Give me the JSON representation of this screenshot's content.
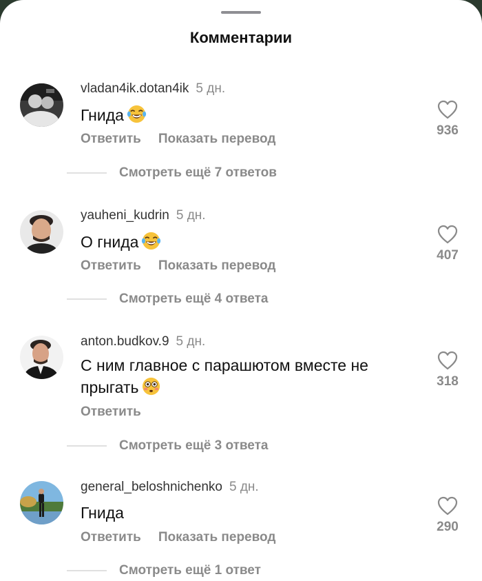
{
  "header": {
    "title": "Комментарии"
  },
  "comments": [
    {
      "username": "vladan4ik.dotan4ik",
      "time": "5 дн.",
      "text": "Гнида",
      "emoji": "laughing-emoji",
      "reply_label": "Ответить",
      "translate_label": "Показать перевод",
      "likes": "936",
      "more_replies": "Смотреть ещё 7 ответов"
    },
    {
      "username": "yauheni_kudrin",
      "time": "5 дн.",
      "text": "О гнида",
      "emoji": "laughing-emoji",
      "reply_label": "Ответить",
      "translate_label": "Показать перевод",
      "likes": "407",
      "more_replies": "Смотреть ещё 4 ответа"
    },
    {
      "username": "anton.budkov.9",
      "time": "5 дн.",
      "text_line1": "С ним главное с парашютом вместе не",
      "text_line2": "прыгать",
      "emoji": "flushed-emoji",
      "reply_label": "Ответить",
      "likes": "318",
      "more_replies": "Смотреть ещё 3 ответа"
    },
    {
      "username": "general_beloshnichenko",
      "time": "5 дн.",
      "text": "Гнида",
      "reply_label": "Ответить",
      "translate_label": "Показать перевод",
      "likes": "290",
      "more_replies": "Смотреть ещё 1 ответ"
    }
  ],
  "colors": {
    "secondary_text": "#8a8a8a",
    "divider": "#e0e0e0",
    "background": "#ffffff"
  }
}
